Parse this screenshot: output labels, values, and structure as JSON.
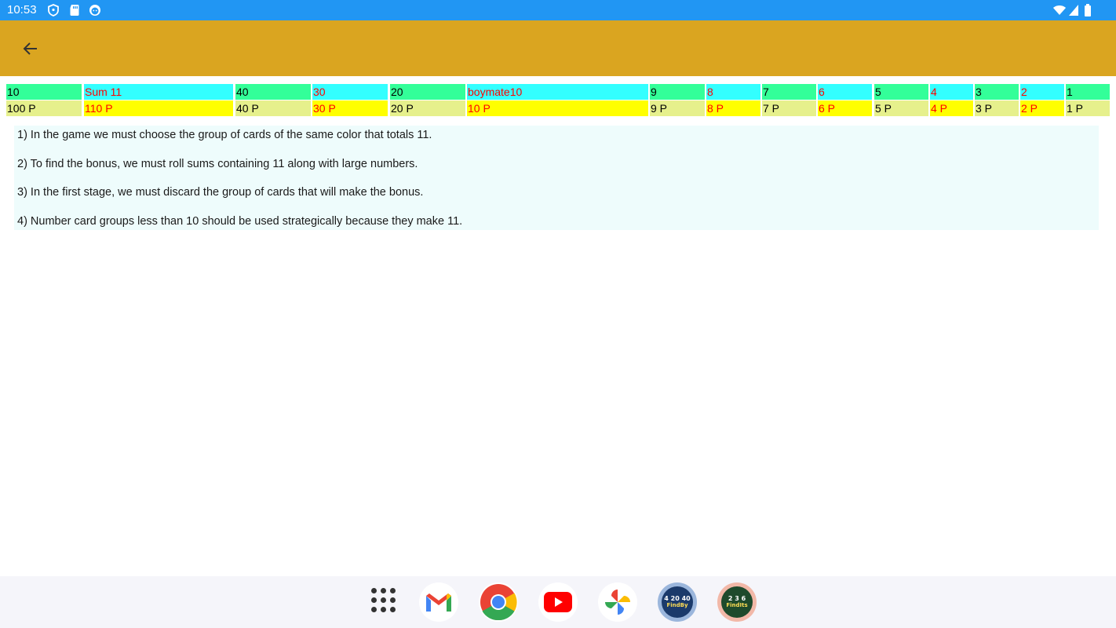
{
  "status_bar": {
    "time": "10:53",
    "background": "#2196f3",
    "left_icons": [
      "shield-icon",
      "sd-card-icon",
      "face-icon"
    ],
    "right_icons": [
      "wifi-icon",
      "signal-icon",
      "battery-icon"
    ]
  },
  "app_bar": {
    "background": "#daa520",
    "back_icon": "arrow-left-icon"
  },
  "score_table": {
    "columns": [
      {
        "top": "10",
        "bottom": "100 P"
      },
      {
        "top": "Sum 11",
        "bottom": "110 P"
      },
      {
        "top": "40",
        "bottom": "40 P"
      },
      {
        "top": "30",
        "bottom": "30 P"
      },
      {
        "top": "20",
        "bottom": "20 P"
      },
      {
        "top": "boymate10",
        "bottom": "10 P"
      },
      {
        "top": "9",
        "bottom": "9 P"
      },
      {
        "top": "8",
        "bottom": "8 P"
      },
      {
        "top": "7",
        "bottom": "7 P"
      },
      {
        "top": "6",
        "bottom": "6 P"
      },
      {
        "top": "5",
        "bottom": "5 P"
      },
      {
        "top": "4",
        "bottom": "4 P"
      },
      {
        "top": "3",
        "bottom": "3 P"
      },
      {
        "top": "2",
        "bottom": "2 P"
      },
      {
        "top": "1",
        "bottom": "1 P"
      }
    ],
    "colors": {
      "green": "#33ff99",
      "cyan": "#33ffff",
      "yellow": "#ffff00",
      "khaki": "#e6f08c",
      "red_text": "#ff0000"
    }
  },
  "rules": [
    "1) In the game we must choose the group of cards of the same color that totals 11.",
    "2) To find the bonus, we must roll sums containing 11 along with large numbers.",
    "3) In the first stage, we must discard the group of cards that will make the bonus.",
    "4) Number card groups less than 10 should be used strategically because they make 11."
  ],
  "dock": {
    "apps": [
      "apps-grid-icon",
      "gmail-icon",
      "chrome-icon",
      "youtube-icon",
      "photos-icon",
      "findby-game-icon",
      "findits-game-icon"
    ],
    "findby_label": "4 20 40",
    "findby_sub": "FindBy",
    "findits_label": "2 3 6",
    "findits_sub": "FindIts"
  }
}
